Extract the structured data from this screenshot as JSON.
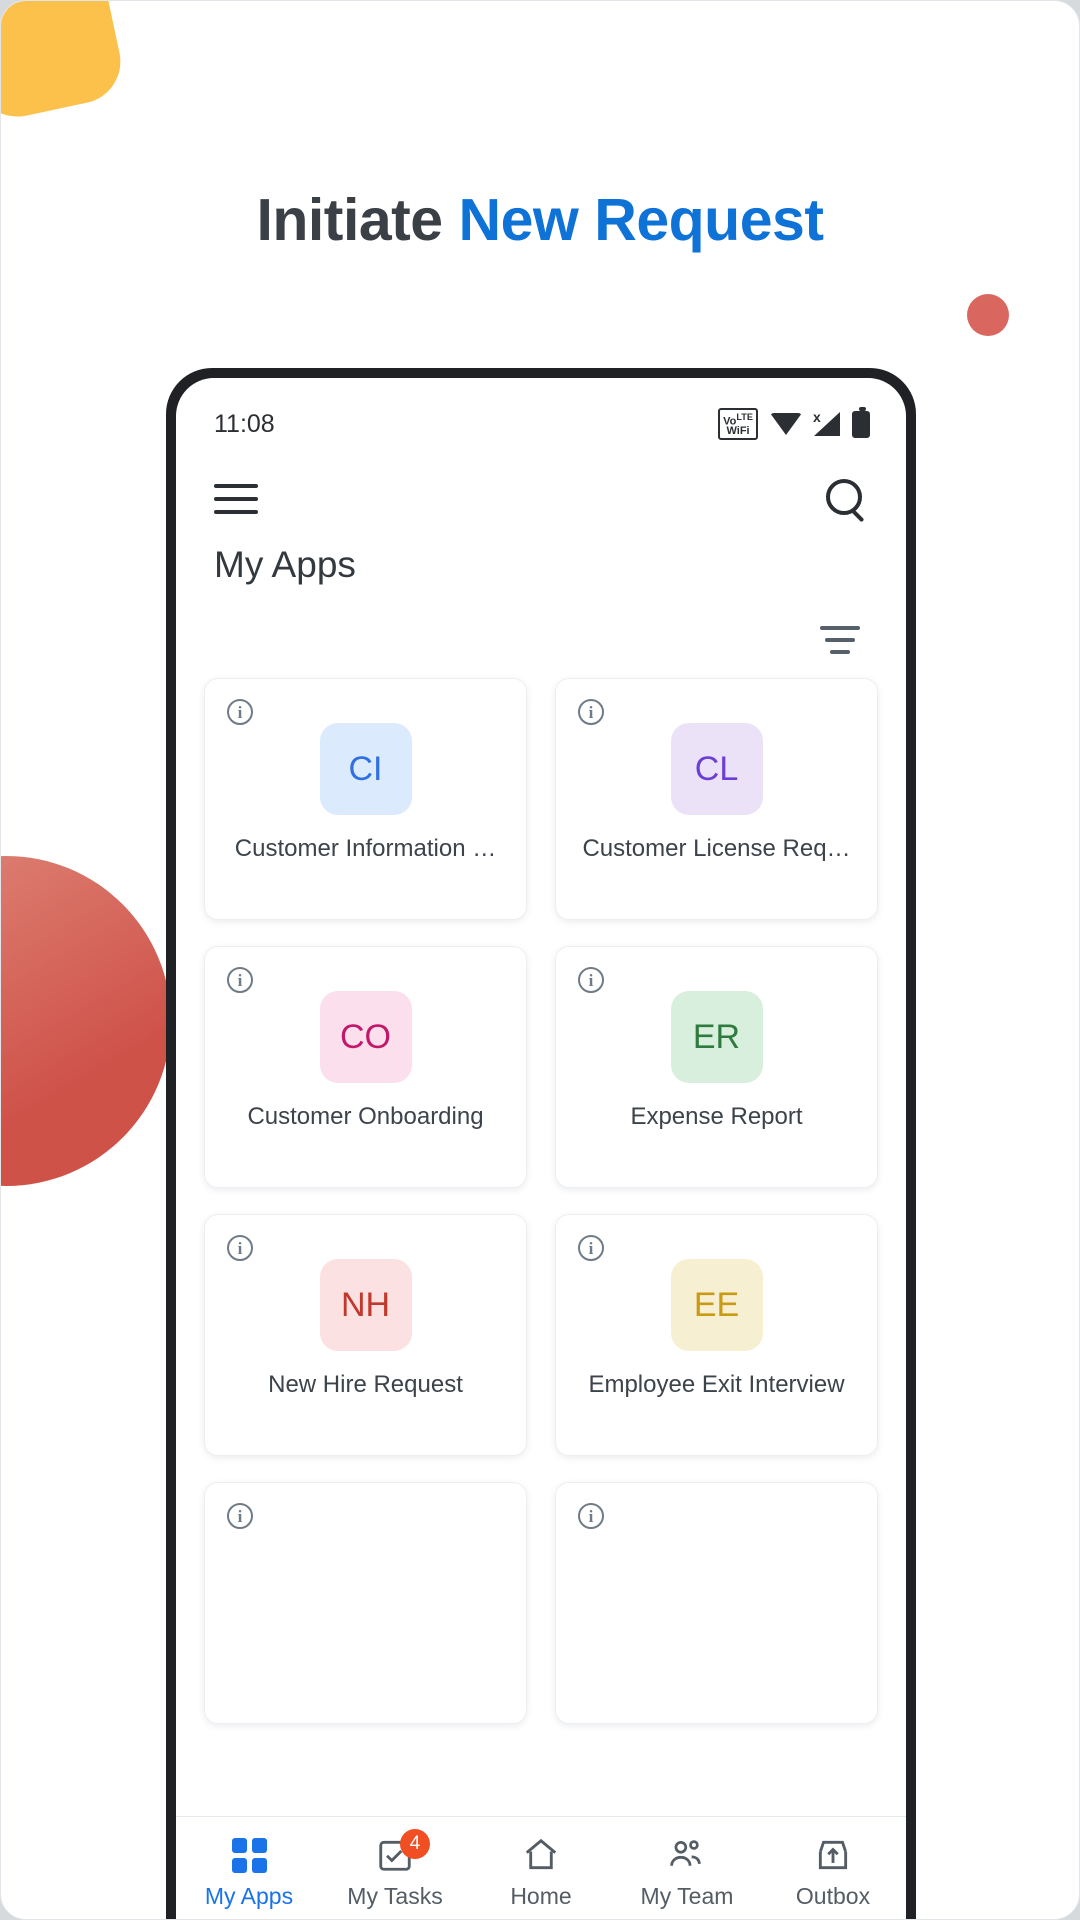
{
  "header": {
    "title_plain": "Initiate ",
    "title_accent": "New Request",
    "accent_color": "#0f72d6",
    "plain_color": "#3a4046"
  },
  "phone": {
    "status_bar": {
      "time": "11:08",
      "icons": [
        "volte-icon",
        "wifi-icon",
        "signal-icon",
        "battery-icon"
      ],
      "volte_label": "VoLTE WiFi"
    },
    "app_bar": {
      "menu_icon": "hamburger-menu-icon",
      "search_icon": "search-icon"
    },
    "page_title": "My Apps",
    "filter_icon": "filter-sort-icon",
    "apps": [
      {
        "initials": "CI",
        "label": "Customer Information …",
        "tile_bg": "#dbeafc",
        "initials_color": "#2f6fe0",
        "info_icon": "info-icon"
      },
      {
        "initials": "CL",
        "label": "Customer License Req…",
        "tile_bg": "#ece2f8",
        "initials_color": "#6b3fd4",
        "info_icon": "info-icon"
      },
      {
        "initials": "CO",
        "label": "Customer Onboarding",
        "tile_bg": "#fbdfec",
        "initials_color": "#c2186b",
        "info_icon": "info-icon"
      },
      {
        "initials": "ER",
        "label": "Expense Report",
        "tile_bg": "#d9efdd",
        "initials_color": "#2f7a3f",
        "info_icon": "info-icon"
      },
      {
        "initials": "NH",
        "label": "New Hire Request",
        "tile_bg": "#fbe1e1",
        "initials_color": "#c0392b",
        "info_icon": "info-icon"
      },
      {
        "initials": "EE",
        "label": "Employee Exit Interview",
        "tile_bg": "#f7efd2",
        "initials_color": "#c99a13",
        "info_icon": "info-icon"
      },
      {
        "initials": "",
        "label": "",
        "tile_bg": "#ffffff",
        "initials_color": "#ffffff",
        "info_icon": "info-icon"
      },
      {
        "initials": "",
        "label": "",
        "tile_bg": "#ffffff",
        "initials_color": "#ffffff",
        "info_icon": "info-icon"
      }
    ],
    "bottom_nav": [
      {
        "label": "My Apps",
        "icon": "apps-grid-icon",
        "active": true,
        "badge": ""
      },
      {
        "label": "My Tasks",
        "icon": "task-checkbox-icon",
        "active": false,
        "badge": "4"
      },
      {
        "label": "Home",
        "icon": "home-icon",
        "active": false,
        "badge": ""
      },
      {
        "label": "My Team",
        "icon": "team-people-icon",
        "active": false,
        "badge": ""
      },
      {
        "label": "Outbox",
        "icon": "outbox-upload-icon",
        "active": false,
        "badge": ""
      }
    ]
  }
}
